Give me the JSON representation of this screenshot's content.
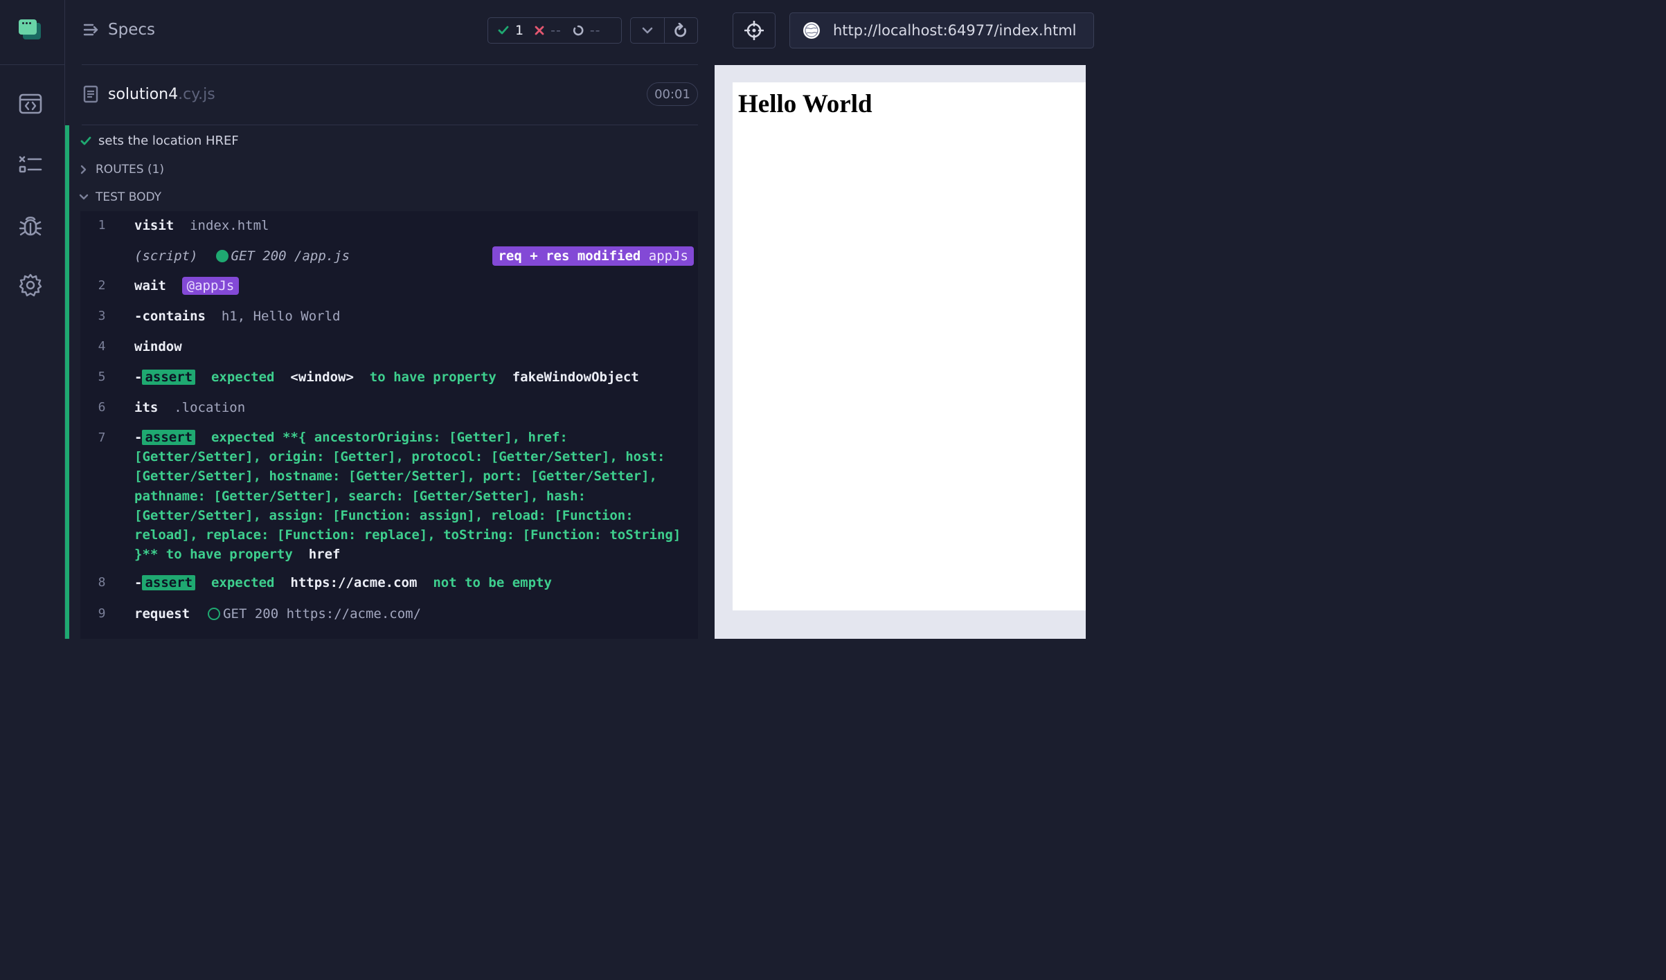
{
  "nav": {
    "items": [
      {
        "name": "specs-nav",
        "icon": "code-browser-icon"
      },
      {
        "name": "runs-nav",
        "icon": "test-results-icon"
      },
      {
        "name": "debug-nav",
        "icon": "bug-icon"
      },
      {
        "name": "settings-nav",
        "icon": "gear-icon"
      }
    ]
  },
  "header": {
    "specs_label": "Specs",
    "passed": "1",
    "failed": "--",
    "pending": "--"
  },
  "spec": {
    "name": "solution4",
    "ext": ".cy.js",
    "duration": "00:01"
  },
  "test": {
    "title": "sets the location HREF",
    "routes_label": "ROUTES (1)",
    "body_label": "TEST BODY"
  },
  "commands": {
    "c1": {
      "num": "1",
      "name": "visit",
      "arg": "index.html"
    },
    "c1b": {
      "type": "(script)",
      "method": "GET 200 /app.js",
      "tag_bold": "req + res modified",
      "tag_name": "appJs"
    },
    "c2": {
      "num": "2",
      "name": "wait",
      "alias": "@appJs"
    },
    "c3": {
      "num": "3",
      "prefix": "-",
      "name": "contains",
      "arg": "h1, Hello World"
    },
    "c4": {
      "num": "4",
      "name": "window"
    },
    "c5": {
      "num": "5",
      "prefix": "-",
      "badge": "assert",
      "t1": "expected",
      "t2": "<window>",
      "t3": "to have property",
      "t4": "fakeWindowObject"
    },
    "c6": {
      "num": "6",
      "name": "its",
      "arg": ".location"
    },
    "c7": {
      "num": "7",
      "prefix": "-",
      "badge": "assert",
      "t1": "expected",
      "t2": "**{ ancestorOrigins: [Getter], href:",
      "lines": [
        "[Getter/Setter], origin: [Getter], protocol: [Getter/Setter], host:",
        "[Getter/Setter], hostname: [Getter/Setter], port: [Getter/Setter],",
        "pathname: [Getter/Setter], search: [Getter/Setter], hash:",
        "[Getter/Setter], assign: [Function: assign], reload: [Function:",
        "reload], replace: [Function: replace], toString: [Function: toString]"
      ],
      "end": "}**",
      "t3": "to have property",
      "t4": "href"
    },
    "c8": {
      "num": "8",
      "prefix": "-",
      "badge": "assert",
      "t1": "expected",
      "t2": "https://acme.com",
      "t3": "not to be empty"
    },
    "c9": {
      "num": "9",
      "name": "request",
      "arg": "GET 200 https://acme.com/"
    }
  },
  "aut": {
    "url": "http://localhost:64977/index.html",
    "heading": "Hello World"
  },
  "colors": {
    "pass": "#1fa971",
    "fail": "#e45770",
    "alias": "#8349d6"
  }
}
